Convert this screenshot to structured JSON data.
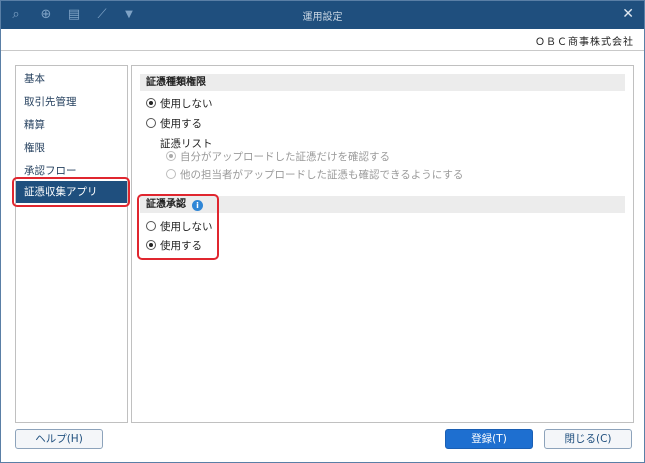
{
  "window": {
    "title": "運用設定",
    "company": "ＯＢＣ商事株式会社",
    "toolbar_icons": [
      "search-plus-icon",
      "magnifier-doc-icon",
      "printer-icon",
      "ruler-pen-icon",
      "dropdown-arrow-icon"
    ],
    "close_glyph": "✕"
  },
  "sidebar": {
    "items": [
      {
        "label": "基本"
      },
      {
        "label": "取引先管理"
      },
      {
        "label": "精算"
      },
      {
        "label": "権限"
      },
      {
        "label": "承認フロー"
      },
      {
        "label": "証憑収集アプリ",
        "selected": true
      }
    ]
  },
  "main": {
    "section1": {
      "title": "証憑種類権限",
      "options": [
        {
          "label": "使用しない",
          "checked": true
        },
        {
          "label": "使用する",
          "checked": false
        }
      ],
      "sublabel": "証憑リスト",
      "suboptions": [
        {
          "label": "自分がアップロードした証憑だけを確認する",
          "checked": true,
          "disabled": true
        },
        {
          "label": "他の担当者がアップロードした証憑も確認できるようにする",
          "checked": false,
          "disabled": true
        }
      ]
    },
    "section2": {
      "title": "証憑承認",
      "info_glyph": "i",
      "options": [
        {
          "label": "使用しない",
          "checked": false
        },
        {
          "label": "使用する",
          "checked": true
        }
      ]
    }
  },
  "buttons": {
    "help": "ヘルプ(H)",
    "register": "登録(T)",
    "close": "閉じる(C)"
  },
  "colors": {
    "titlebar": "#1f4f7e",
    "selected": "#1f4f7e",
    "highlight": "#e0262f",
    "primary_button": "#1e6fd0"
  }
}
